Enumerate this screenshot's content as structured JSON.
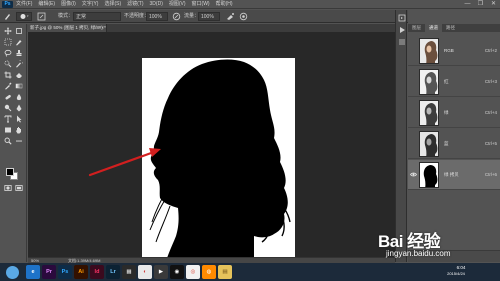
{
  "app": {
    "logo": "Ps"
  },
  "menu": [
    "文件(F)",
    "编辑(E)",
    "图像(I)",
    "文字(Y)",
    "选择(S)",
    "滤镜(T)",
    "3D(D)",
    "视图(V)",
    "窗口(W)",
    "帮助(H)"
  ],
  "window_controls": {
    "minimize": "—",
    "restore": "❐",
    "close": "✕"
  },
  "options": {
    "mode_label": "模式：",
    "mode_value": "正常",
    "opacity_label": "不透明度：",
    "opacity_value": "100%",
    "flow_label": "流量：",
    "flow_value": "100%"
  },
  "document": {
    "tab_title": "新子.jpg @ 50% (图层 1 拷贝, 绿/8#) *",
    "tab_close": "×"
  },
  "status": {
    "zoom": "50%",
    "doc": "文档:1.39M/4.69M"
  },
  "panel": {
    "tabs": [
      "图层",
      "通道",
      "路径"
    ],
    "active_tab": 1,
    "channels": [
      {
        "name": "RGB",
        "shortcut": "Ctrl+2",
        "visible": false
      },
      {
        "name": "红",
        "shortcut": "Ctrl+3",
        "visible": false
      },
      {
        "name": "绿",
        "shortcut": "Ctrl+4",
        "visible": false
      },
      {
        "name": "蓝",
        "shortcut": "Ctrl+5",
        "visible": false
      },
      {
        "name": "绿 拷贝",
        "shortcut": "Ctrl+6",
        "visible": true,
        "selected": true
      }
    ]
  },
  "watermark": {
    "logo": "Bai 经验",
    "url": "jingyan.baidu.com"
  },
  "taskbar": {
    "apps": [
      {
        "name": "IE",
        "color": "#1e73c9",
        "text": "e"
      },
      {
        "name": "Premiere",
        "color": "#2a0a3d",
        "text": "Pr",
        "fg": "#e28bff"
      },
      {
        "name": "Photoshop",
        "color": "#0e2c47",
        "text": "Ps",
        "fg": "#31a8ff"
      },
      {
        "name": "Illustrator",
        "color": "#331100",
        "text": "Ai",
        "fg": "#ff9a00"
      },
      {
        "name": "InDesign",
        "color": "#3b0a1e",
        "text": "Id",
        "fg": "#ff3366"
      },
      {
        "name": "Lightroom",
        "color": "#0c2233",
        "text": "Lr",
        "fg": "#74c8ff"
      },
      {
        "name": "Media",
        "color": "#2a2a2a",
        "text": "▦",
        "fg": "#e8e8e8"
      },
      {
        "name": "Ball",
        "color": "#e9e9e9",
        "text": "◐",
        "fg": "#d13a3a"
      },
      {
        "name": "Media2",
        "color": "#3a3a3a",
        "text": "▶",
        "fg": "#ffffff"
      },
      {
        "name": "QQ",
        "color": "#111111",
        "text": "◉",
        "fg": "#ffffff"
      },
      {
        "name": "Chrome",
        "color": "#f1f1f1",
        "text": "◎",
        "fg": "#db4437"
      },
      {
        "name": "Firefox",
        "color": "#ff8a00",
        "text": "◍",
        "fg": "#ffffff"
      },
      {
        "name": "Explorer",
        "color": "#e6c35b",
        "text": "▤",
        "fg": "#6b4b12"
      }
    ],
    "time": "6:04",
    "date": "2015/4/24"
  },
  "colors": {
    "foreground": "#000000",
    "background": "#ffffff",
    "arrow": "#d21f1f"
  }
}
